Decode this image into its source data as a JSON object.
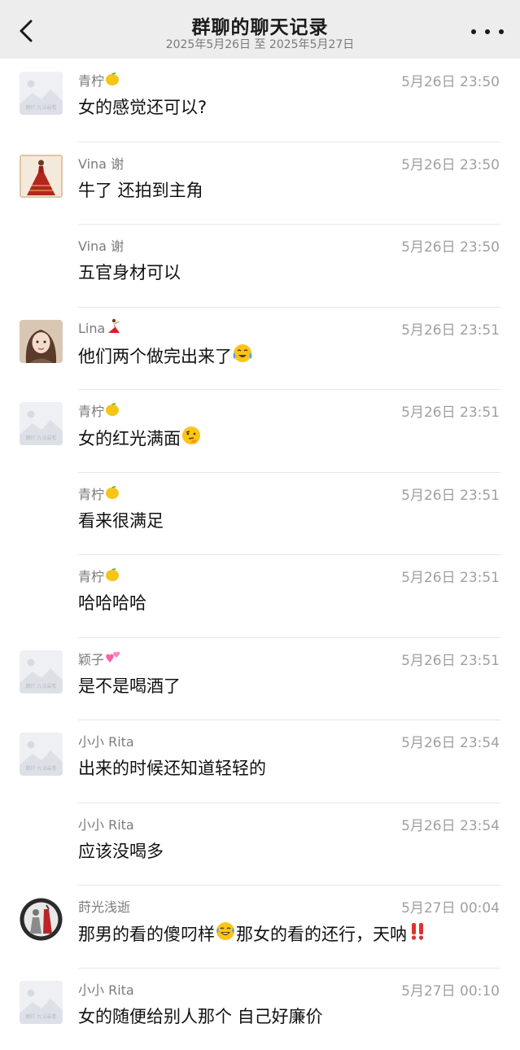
{
  "header": {
    "title": "群聊的聊天记录",
    "subtitle": "2025年5月26日 至 2025年5月27日"
  },
  "placeholder_avatar_text": "鵝柠.九法最看",
  "messages": [
    {
      "sender": "青柠",
      "sender_emoji": "lemon",
      "avatar": "placeholder",
      "time": "5月26日 23:50",
      "text": "女的感觉还可以?",
      "text_emoji": []
    },
    {
      "sender": "Vina 谢",
      "sender_emoji": "",
      "avatar": "dress",
      "time": "5月26日 23:50",
      "text": "牛了 还拍到主角",
      "text_emoji": []
    },
    {
      "sender": "Vina 谢",
      "sender_emoji": "",
      "avatar": "none",
      "time": "5月26日 23:50",
      "text": "五官身材可以",
      "text_emoji": []
    },
    {
      "sender": "Lina",
      "sender_emoji": "dancer",
      "avatar": "girl",
      "time": "5月26日 23:51",
      "text": "他们两个做完出来了",
      "text_emoji": [
        "crying-laugh"
      ]
    },
    {
      "sender": "青柠",
      "sender_emoji": "lemon",
      "avatar": "placeholder",
      "time": "5月26日 23:51",
      "text": "女的红光满面",
      "text_emoji": [
        "thinking"
      ]
    },
    {
      "sender": "青柠",
      "sender_emoji": "lemon",
      "avatar": "none",
      "time": "5月26日 23:51",
      "text": "看来很满足",
      "text_emoji": []
    },
    {
      "sender": "青柠",
      "sender_emoji": "lemon",
      "avatar": "none",
      "time": "5月26日 23:51",
      "text": "哈哈哈哈",
      "text_emoji": []
    },
    {
      "sender": "颖子",
      "sender_emoji": "hearts",
      "avatar": "placeholder",
      "time": "5月26日 23:51",
      "text": "是不是喝酒了",
      "text_emoji": []
    },
    {
      "sender": "小小 Rita",
      "sender_emoji": "",
      "avatar": "placeholder",
      "time": "5月26日 23:54",
      "text": "出来的时候还知道轻轻的",
      "text_emoji": []
    },
    {
      "sender": "小小 Rita",
      "sender_emoji": "",
      "avatar": "none",
      "time": "5月26日 23:54",
      "text": "应该没喝多",
      "text_emoji": []
    },
    {
      "sender": "莳光浅逝",
      "sender_emoji": "",
      "avatar": "dark",
      "time": "5月27日 00:04",
      "text": "那男的看的傻叼样",
      "text2": "那女的看的还行，天呐",
      "text_emoji": [
        "tears-of-joy",
        "double-exclamation"
      ]
    },
    {
      "sender": "小小 Rita",
      "sender_emoji": "",
      "avatar": "placeholder",
      "time": "5月27日 00:10",
      "text": "女的随便给别人那个 自己好廉价",
      "text_emoji": []
    }
  ]
}
